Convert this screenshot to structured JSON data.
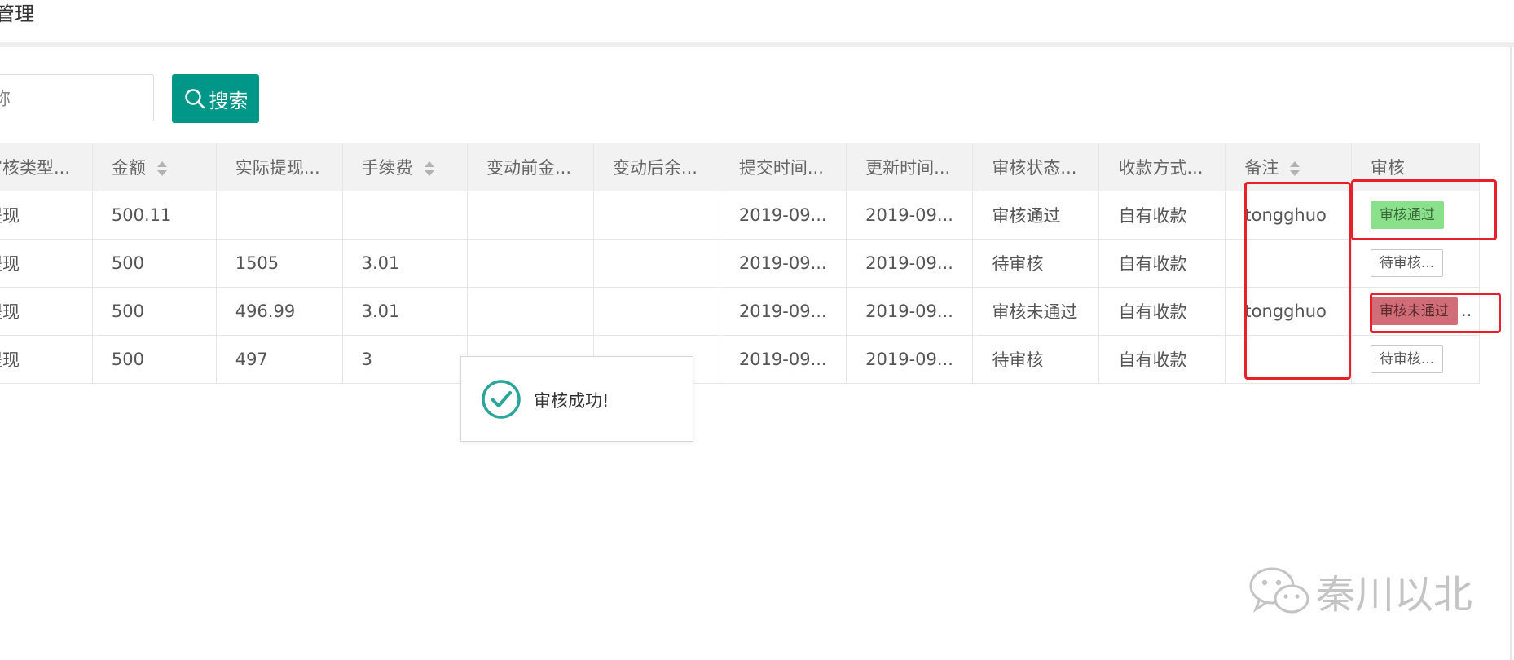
{
  "header": {
    "title": "管理"
  },
  "search": {
    "input_value": "称",
    "button_label": "搜索"
  },
  "table": {
    "columns": [
      {
        "label": "审核类型...",
        "sortable": false
      },
      {
        "label": "金额",
        "sortable": true
      },
      {
        "label": "实际提现...",
        "sortable": false
      },
      {
        "label": "手续费",
        "sortable": true
      },
      {
        "label": "变动前金...",
        "sortable": false
      },
      {
        "label": "变动后余...",
        "sortable": false
      },
      {
        "label": "提交时间...",
        "sortable": false
      },
      {
        "label": "更新时间...",
        "sortable": false
      },
      {
        "label": "审核状态...",
        "sortable": false
      },
      {
        "label": "收款方式...",
        "sortable": false
      },
      {
        "label": "备注",
        "sortable": true
      },
      {
        "label": "审核",
        "sortable": false
      }
    ],
    "rows": [
      {
        "cells": [
          "提现",
          "500.11",
          "",
          "",
          "",
          "",
          "2019-09...",
          "2019-09...",
          "审核通过",
          "自有收款",
          "tongghuo"
        ],
        "action": {
          "label": "审核通过",
          "type": "pass",
          "more": ""
        }
      },
      {
        "cells": [
          "提现",
          "500",
          "1505",
          "3.01",
          "",
          "",
          "2019-09...",
          "2019-09...",
          "待审核",
          "自有收款",
          ""
        ],
        "action": {
          "label": "待审核...",
          "type": "pending",
          "more": ""
        }
      },
      {
        "cells": [
          "提现",
          "500",
          "496.99",
          "3.01",
          "",
          "",
          "2019-09...",
          "2019-09...",
          "审核未通过",
          "自有收款",
          "tongghuo"
        ],
        "action": {
          "label": "审核未通过",
          "type": "fail",
          "more": ".."
        }
      },
      {
        "cells": [
          "提现",
          "500",
          "497",
          "3",
          "",
          "",
          "2019-09...",
          "2019-09...",
          "待审核",
          "自有收款",
          ""
        ],
        "action": {
          "label": "待审核...",
          "type": "pending",
          "more": ""
        }
      }
    ]
  },
  "toast": {
    "message": "审核成功!",
    "icon": "check-circle-icon"
  },
  "watermark": {
    "text": "秦川以北",
    "icon": "wechat-icon"
  },
  "colors": {
    "primary": "#009688",
    "pass_tag": "#8be08b",
    "fail_tag": "#d16d77",
    "highlight": "#e8202a"
  }
}
